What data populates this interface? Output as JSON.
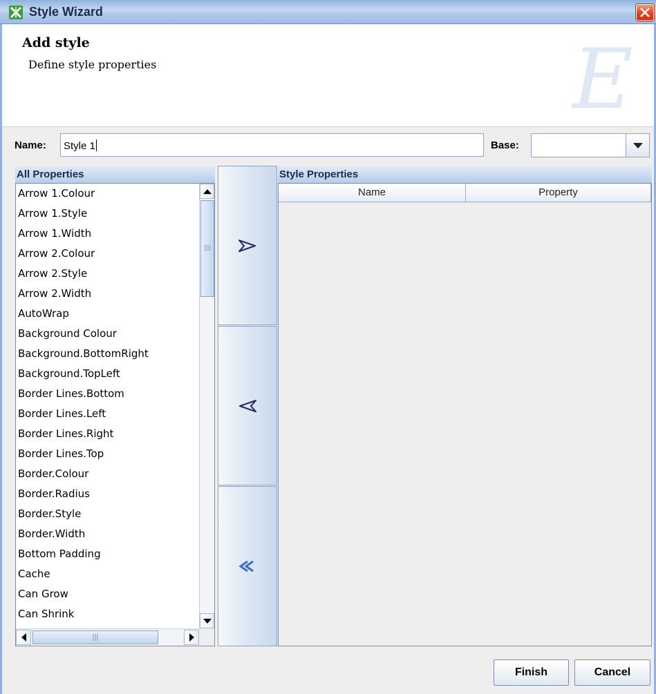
{
  "window": {
    "title": "Style Wizard"
  },
  "header": {
    "title": "Add style",
    "subtitle": "Define style properties",
    "logo_letter": "E"
  },
  "form": {
    "name_label": "Name:",
    "name_value": "Style 1",
    "base_label": "Base:",
    "base_value": ""
  },
  "all_properties": {
    "title": "All Properties",
    "items": [
      "Arrow 1.Colour",
      "Arrow 1.Style",
      "Arrow 1.Width",
      "Arrow 2.Colour",
      "Arrow 2.Style",
      "Arrow 2.Width",
      "AutoWrap",
      "Background Colour",
      "Background.BottomRight",
      "Background.TopLeft",
      "Border Lines.Bottom",
      "Border Lines.Left",
      "Border Lines.Right",
      "Border Lines.Top",
      "Border.Colour",
      "Border.Radius",
      "Border.Style",
      "Border.Width",
      "Bottom Padding",
      "Cache",
      "Can Grow",
      "Can Shrink"
    ]
  },
  "move_buttons": {
    "add": "add-arrow",
    "remove": "remove-arrow",
    "remove_all": "remove-all-arrows"
  },
  "style_properties": {
    "title": "Style Properties",
    "columns": [
      "Name",
      "Property"
    ],
    "rows": []
  },
  "footer": {
    "finish_label": "Finish",
    "cancel_label": "Cancel"
  },
  "colors": {
    "title_bar": "#a0bde3",
    "close_button": "#e04a2a",
    "panel_header": "#b7cde8"
  }
}
